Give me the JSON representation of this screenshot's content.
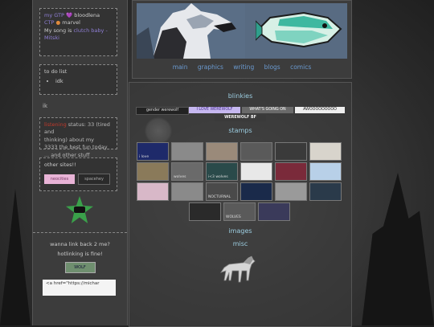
{
  "sidebar": {
    "box1": {
      "line1_label": "my GTP",
      "line1_value": "bloodlena",
      "line2_label": "CTP",
      "line2_value": "marvel",
      "line3_label": "My song is",
      "line3_value": "clutch baby",
      "line3_extra": "- Mitski"
    },
    "todo_title": "to do list",
    "todo_items": [
      "idk"
    ],
    "ik_label": "ik",
    "box3_lines": [
      "status: 33 (tired and",
      "thinking) about my",
      "3333 the best fun today",
      "... and other stuff"
    ],
    "box3_red": "listening",
    "other_sites_title": "other sites!!",
    "other_site_1": "neocities",
    "other_site_2": "spacehey",
    "link_back_question": "wanna link back 2 me?",
    "hotlinking": "hotlinking is fine!",
    "link_button": "WOLF",
    "code_text": "<a href=\"https://michar"
  },
  "header": {
    "nav": [
      "main",
      "graphics",
      "writing",
      "blogs",
      "comics"
    ]
  },
  "main": {
    "blinkies_title": "blinkies",
    "blinkies": [
      "gender werewolf",
      "I LOVE WEREWOLF",
      "WHAT'S GOING ON",
      "AWOOOOOOOOO",
      "WEREWOLF BF"
    ],
    "stamps_title": "stamps",
    "stamps": [
      "i love",
      "",
      "",
      "",
      "",
      "",
      "",
      "wolves",
      "i<3 wolves",
      "",
      "",
      "",
      "",
      "",
      "NOCTURNAL",
      "",
      "",
      "",
      "",
      "WOLVES",
      ""
    ],
    "images_title": "images",
    "misc_title": "misc"
  },
  "colors": {
    "background": "#2e2e2e",
    "panel": "#3c3c3c",
    "nav_link": "#6b9bd1",
    "heading": "#9ccde0",
    "accent_purple": "#8f7fd6",
    "accent_orange": "#e08a3c",
    "badge_green": "#3aa04a"
  },
  "icons": [
    "howling-wolf-icon",
    "pixel-fish-icon",
    "star-badge-icon",
    "walking-wolf-icon"
  ]
}
